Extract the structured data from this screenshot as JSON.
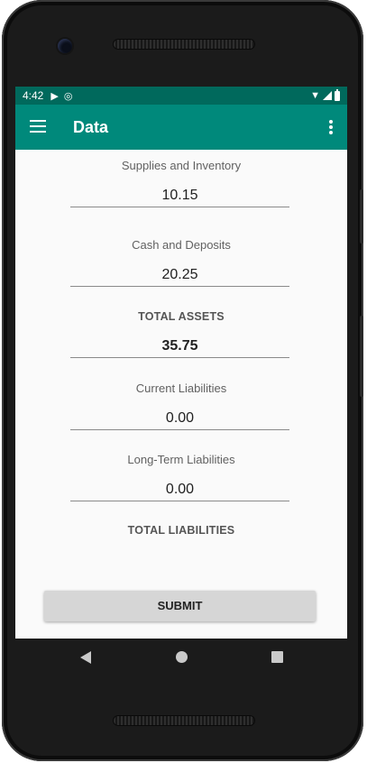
{
  "status_bar": {
    "time": "4:42",
    "icons": [
      "play-store-icon",
      "sync-icon",
      "wifi-icon",
      "signal-icon",
      "battery-icon"
    ]
  },
  "app_bar": {
    "title": "Data",
    "background": "#00897b",
    "status_background": "#00695c"
  },
  "form": {
    "supplies_label": "Supplies and Inventory",
    "supplies_value": "10.15",
    "cash_label": "Cash and Deposits",
    "cash_value": "20.25",
    "total_assets_label": "TOTAL ASSETS",
    "total_assets_value": "35.75",
    "current_liabilities_label": "Current Liabilities",
    "current_liabilities_value": "0.00",
    "long_term_liabilities_label": "Long-Term Liabilities",
    "long_term_liabilities_value": "0.00",
    "total_liabilities_label": "TOTAL LIABILITIES",
    "submit_label": "SUBMIT"
  }
}
